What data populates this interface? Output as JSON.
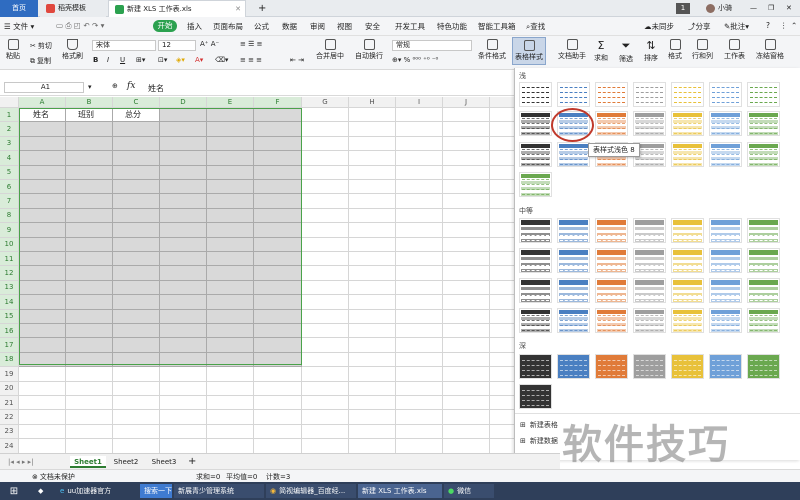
{
  "tabs": {
    "home": "首页",
    "template": "稻壳模板",
    "file": "新建 XLS 工作表.xls",
    "add": "+"
  },
  "window": {
    "badge": "1",
    "user": "小骑"
  },
  "menu": {
    "file": "文件",
    "items": [
      "开始",
      "插入",
      "页面布局",
      "公式",
      "数据",
      "审阅",
      "视图",
      "安全",
      "开发工具",
      "特色功能",
      "智能工具箱"
    ],
    "search": "查找",
    "sync": "未同步",
    "share": "分享",
    "comment": "批注"
  },
  "ribbon": {
    "paste": "粘贴",
    "cut": "剪切",
    "copy": "复制",
    "format_painter": "格式刷",
    "font_name": "宋体",
    "font_size": "12",
    "merge": "合并居中",
    "wrap": "自动换行",
    "number_format": "常规",
    "cond_format": "条件格式",
    "table_style": "表格样式",
    "doc_helper": "文档助手",
    "sum": "求和",
    "filter": "筛选",
    "sort": "排序",
    "format": "格式",
    "rowcol": "行和列",
    "sheet": "工作表",
    "freeze": "冻结窗格"
  },
  "formula_bar": {
    "cell_ref": "A1",
    "fx": "fx",
    "content": "姓名"
  },
  "columns": [
    "A",
    "B",
    "C",
    "D",
    "E",
    "F",
    "G",
    "H",
    "I",
    "J"
  ],
  "rows": [
    "1",
    "2",
    "3",
    "4",
    "5",
    "6",
    "7",
    "8",
    "9",
    "10",
    "11",
    "12",
    "13",
    "14",
    "15",
    "16",
    "17",
    "18",
    "19",
    "20",
    "21",
    "22",
    "23",
    "24"
  ],
  "headers": [
    "姓名",
    "班别",
    "总分"
  ],
  "sheets": [
    "Sheet1",
    "Sheet2",
    "Sheet3"
  ],
  "sheet_add": "+",
  "status": {
    "protect": "文档未保护",
    "sum": "求和=0",
    "avg": "平均值=0",
    "count": "计数=3"
  },
  "panel": {
    "light": "浅",
    "medium": "中等",
    "dark": "深",
    "tooltip": "表样式浅色 8",
    "new_table_style": "新建表格",
    "new_pivot_style": "新建数据"
  },
  "palette": {
    "black": "#333333",
    "blue": "#4a7fc1",
    "orange": "#e07b39",
    "gray": "#9e9e9e",
    "yellow": "#e8c13a",
    "lightblue": "#6fa0d8",
    "green": "#6aa84f",
    "accent_green": "#2ba14f",
    "tab_blue": "#2f6cc1"
  },
  "taskbar": [
    "uu加速器官方",
    "搜索一下",
    "新展青少管理系统",
    "简视编辑器_百度经...",
    "新建 XLS 工作表.xls",
    "微信"
  ],
  "watermark": "软件技巧"
}
